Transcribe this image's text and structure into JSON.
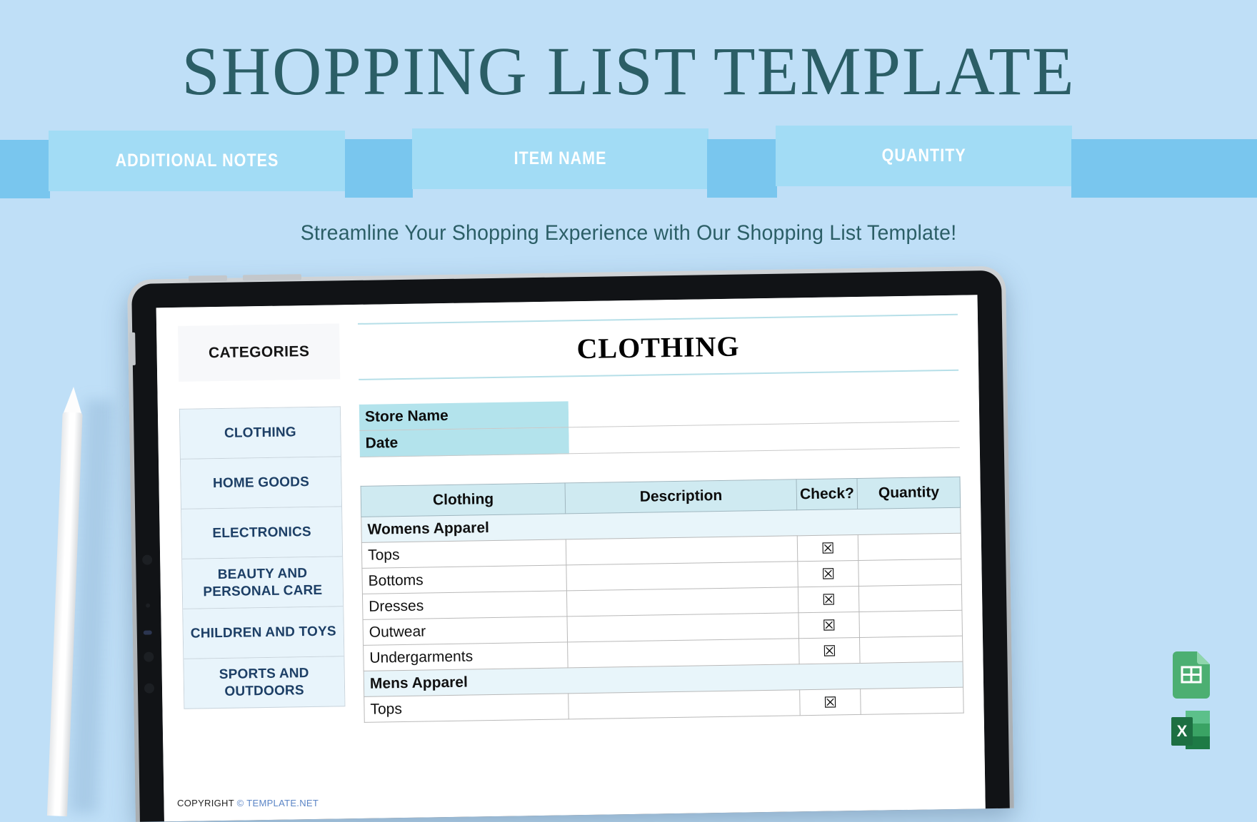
{
  "page": {
    "title": "SHOPPING LIST TEMPLATE",
    "subtitle": "Streamline Your Shopping Experience with Our Shopping List Template!",
    "background_color": "#bfdff7",
    "title_color": "#2b5e66"
  },
  "banner": {
    "light_color": "#a2dcf5",
    "dark_color": "#79c6ee",
    "chips": [
      {
        "label": "ADDITIONAL NOTES"
      },
      {
        "label": "ITEM NAME"
      },
      {
        "label": "QUANTITY"
      }
    ]
  },
  "sheet": {
    "sidebar": {
      "header": "CATEGORIES",
      "items": [
        {
          "label": "CLOTHING"
        },
        {
          "label": "HOME GOODS"
        },
        {
          "label": "ELECTRONICS"
        },
        {
          "label": "BEAUTY AND PERSONAL CARE"
        },
        {
          "label": "CHILDREN AND TOYS"
        },
        {
          "label": "SPORTS AND OUTDOORS"
        }
      ]
    },
    "section_title": "CLOTHING",
    "meta": [
      {
        "label": "Store Name",
        "value": ""
      },
      {
        "label": "Date",
        "value": ""
      }
    ],
    "table": {
      "headers": [
        "Clothing",
        "Description",
        "Check?",
        "Quantity"
      ],
      "groups": [
        {
          "name": "Womens Apparel",
          "rows": [
            {
              "item": "Tops",
              "description": "",
              "check": "☒",
              "quantity": ""
            },
            {
              "item": "Bottoms",
              "description": "",
              "check": "☒",
              "quantity": ""
            },
            {
              "item": "Dresses",
              "description": "",
              "check": "☒",
              "quantity": ""
            },
            {
              "item": "Outwear",
              "description": "",
              "check": "☒",
              "quantity": ""
            },
            {
              "item": "Undergarments",
              "description": "",
              "check": "☒",
              "quantity": ""
            }
          ]
        },
        {
          "name": "Mens Apparel",
          "rows": [
            {
              "item": "Tops",
              "description": "",
              "check": "☒",
              "quantity": ""
            }
          ]
        }
      ]
    },
    "copyright": {
      "prefix": "COPYRIGHT ",
      "brand": "© TEMPLATE.NET"
    }
  },
  "app_icons": [
    {
      "name": "google-sheets-icon",
      "color": "#4caf72"
    },
    {
      "name": "microsoft-excel-icon",
      "color": "#1d6f42"
    }
  ]
}
